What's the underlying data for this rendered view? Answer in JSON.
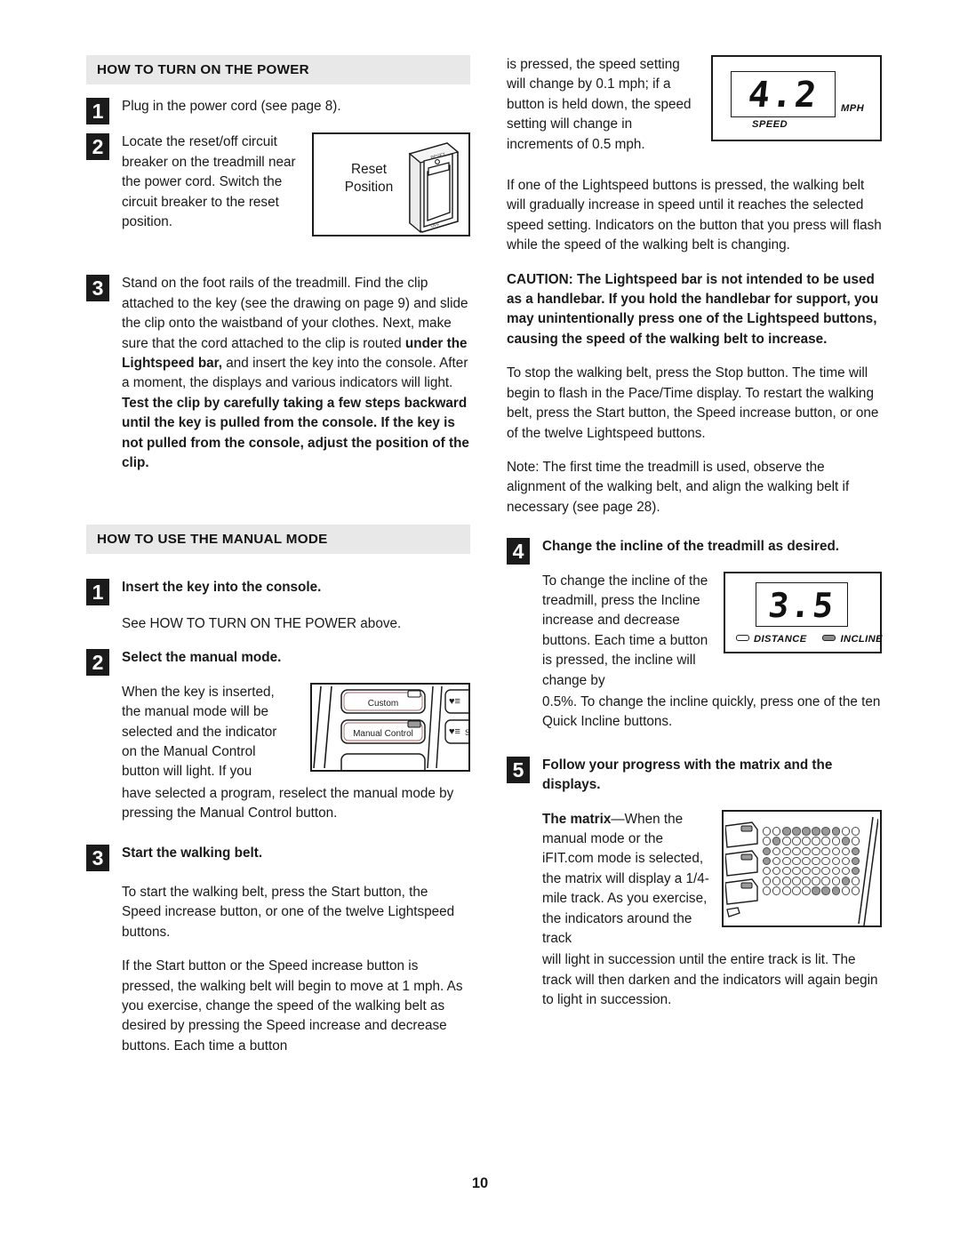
{
  "page": {
    "number": "10"
  },
  "left_column": {
    "section1": {
      "heading": "HOW TO TURN ON THE POWER",
      "steps": [
        {
          "num": "1",
          "text": "Plug in the power cord (see page 8)."
        },
        {
          "num": "2",
          "text": "Locate the reset/off circuit breaker on the treadmill near the power cord. Switch the circuit breaker to the reset position."
        },
        {
          "num": "3",
          "text_part1": "Stand on the foot rails of the treadmill. Find the clip attached to the key (see the drawing on page 9) and slide the clip onto the waistband of your clothes. Next, make sure that the cord attached to the clip is routed ",
          "bold1": "under the Lightspeed bar,",
          "text_part2": " and insert the key into the console. After a moment, the displays and various indicators will light. ",
          "bold2": "Test the clip by carefully taking a few steps backward until the key is pulled from the console. If the key is not pulled from the console, adjust the position of the clip."
        }
      ],
      "breaker_figure": {
        "label_line1": "Reset",
        "label_line2": "Position",
        "switch_top_label": "RESET",
        "switch_bottom_label": "OFF"
      }
    },
    "section2": {
      "heading": "HOW TO USE THE MANUAL MODE",
      "steps": [
        {
          "num": "1",
          "title": "Insert the key into the console.",
          "body": "See HOW TO TURN ON THE POWER above."
        },
        {
          "num": "2",
          "title": "Select the manual mode.",
          "body_narrow": "When the key is inserted, the manual mode will be selected and the indicator on the Manual Control button will light. If you",
          "body_wide": "have selected a program, reselect the manual mode by pressing the Manual Control button."
        },
        {
          "num": "3",
          "title": "Start the walking belt.",
          "body1": "To start the walking belt, press the Start button, the Speed increase button, or one of the twelve Lightspeed buttons.",
          "body2": "If the Start button or the Speed increase button is pressed, the walking belt will begin to move at 1 mph. As you exercise, change the speed of the walking belt as desired by pressing the Speed increase and decrease buttons. Each time a button"
        }
      ],
      "console_figure": {
        "button_custom": "Custom",
        "button_manual_control": "Manual Control"
      }
    }
  },
  "right_column": {
    "para_continued": "is pressed, the speed setting will change by 0.1 mph; if a button is held down, the speed setting will change in increments of 0.5 mph.",
    "para_lightspeed": "If one of the Lightspeed buttons is pressed, the walking belt will gradually increase in speed until it reaches the selected speed setting. Indicators on the button that you press will flash while the speed of the walking belt is changing.",
    "caution": "CAUTION: The Lightspeed bar is not intended to be used as a handlebar. If you hold the handlebar for support, you may unintentionally press one of the Lightspeed buttons, causing the speed of the walking belt to increase.",
    "para_stop": "To stop the walking belt, press the Stop button. The time will begin to flash in the Pace/Time display. To restart the walking belt, press the Start button, the Speed increase button, or one of the twelve Lightspeed buttons.",
    "para_note": "Note: The first time the treadmill is used, observe the alignment of the walking belt, and align the walking belt if necessary (see page 28).",
    "speed_display": {
      "value": "4.2",
      "unit": "MPH",
      "label": "SPEED"
    },
    "steps": [
      {
        "num": "4",
        "title": "Change the incline of the treadmill as desired.",
        "body_narrow": "To change the incline of the treadmill, press the Incline increase and decrease buttons. Each time a button is pressed, the incline will change by",
        "body_wide": "0.5%. To change the incline quickly, press one of the ten Quick Incline buttons."
      },
      {
        "num": "5",
        "title": "Follow your progress with the matrix and the displays.",
        "body_bold": "The matrix",
        "body_narrow": "—When the manual mode or the iFIT.com mode is selected, the matrix will display a 1/4-mile track. As you exercise, the indicators around the track",
        "body_wide": "will light in succession until the entire track is lit. The track will then darken and the indicators will again begin to light in succession."
      }
    ],
    "incline_display": {
      "value": "3.5",
      "indicator_distance": "DISTANCE",
      "indicator_incline": "INCLINE",
      "distance_state": "off",
      "incline_state": "on"
    },
    "matrix_figure": {
      "rows": [
        [
          0,
          0,
          1,
          1,
          1,
          1,
          1,
          1,
          0,
          0
        ],
        [
          0,
          1,
          0,
          0,
          0,
          0,
          0,
          0,
          1,
          0
        ],
        [
          1,
          0,
          0,
          0,
          0,
          0,
          0,
          0,
          0,
          1
        ],
        [
          1,
          0,
          0,
          0,
          0,
          0,
          0,
          0,
          0,
          1
        ],
        [
          0,
          0,
          0,
          0,
          0,
          0,
          0,
          0,
          0,
          1
        ],
        [
          0,
          0,
          0,
          0,
          0,
          0,
          0,
          0,
          1,
          0
        ],
        [
          0,
          0,
          0,
          0,
          0,
          1,
          1,
          1,
          0,
          0
        ]
      ]
    }
  },
  "colors": {
    "header_bar": "#e8e8e8",
    "step_box": "#1b1b1b",
    "text": "#1a1a1a",
    "dot_on": "#9a9a9a"
  }
}
